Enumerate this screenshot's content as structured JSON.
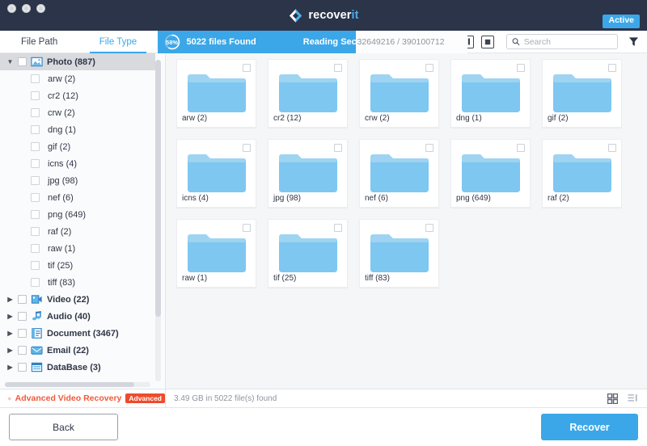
{
  "window": {
    "traffic_lights": [
      "close",
      "minimize",
      "maximize"
    ],
    "brand_main": "recover",
    "brand_accent": "it",
    "status_badge": "Active",
    "titlebar_color": "#2b3449",
    "accent_color": "#3ba7e8"
  },
  "tabs": [
    {
      "label": "File Path",
      "active": false
    },
    {
      "label": "File Type",
      "active": true
    }
  ],
  "scan": {
    "percent": "58%",
    "percent_value": 58,
    "files_found": "5022 files Found",
    "sectors_label": "Reading Sectors:",
    "sectors_value": "32649216 / 390100712"
  },
  "toolbar": {
    "pause_icon": "pause-icon",
    "stop_icon": "stop-icon",
    "search_placeholder": "Search",
    "search_value": "",
    "search_icon": "search-icon",
    "filter_icon": "filter-funnel-icon"
  },
  "sidebar": {
    "groups": [
      {
        "label": "Photo (887)",
        "icon": "photo-icon",
        "expanded": true,
        "selected": true,
        "children": [
          {
            "label": "arw (2)"
          },
          {
            "label": "cr2 (12)"
          },
          {
            "label": "crw (2)"
          },
          {
            "label": "dng (1)"
          },
          {
            "label": "gif (2)"
          },
          {
            "label": "icns (4)"
          },
          {
            "label": "jpg (98)"
          },
          {
            "label": "nef (6)"
          },
          {
            "label": "png (649)"
          },
          {
            "label": "raf (2)"
          },
          {
            "label": "raw (1)"
          },
          {
            "label": "tif (25)"
          },
          {
            "label": "tiff (83)"
          }
        ]
      },
      {
        "label": "Video (22)",
        "icon": "video-icon",
        "expanded": false,
        "selected": false,
        "children": []
      },
      {
        "label": "Audio (40)",
        "icon": "audio-icon",
        "expanded": false,
        "selected": false,
        "children": []
      },
      {
        "label": "Document (3467)",
        "icon": "document-icon",
        "expanded": false,
        "selected": false,
        "children": []
      },
      {
        "label": "Email (22)",
        "icon": "email-icon",
        "expanded": false,
        "selected": false,
        "children": []
      },
      {
        "label": "DataBase (3)",
        "icon": "database-icon",
        "expanded": false,
        "selected": false,
        "children": []
      }
    ]
  },
  "content": {
    "folders": [
      {
        "label": "arw (2)"
      },
      {
        "label": "cr2 (12)"
      },
      {
        "label": "crw (2)"
      },
      {
        "label": "dng (1)"
      },
      {
        "label": "gif (2)"
      },
      {
        "label": "icns (4)"
      },
      {
        "label": "jpg (98)"
      },
      {
        "label": "nef (6)"
      },
      {
        "label": "png (649)"
      },
      {
        "label": "raf (2)"
      },
      {
        "label": "raw (1)"
      },
      {
        "label": "tif (25)"
      },
      {
        "label": "tiff (83)"
      }
    ]
  },
  "statusbar": {
    "advanced_label": "Advanced Video Recovery",
    "advanced_badge": "Advanced",
    "advanced_icon": "advanced-recovery-icon",
    "summary": "3.49 GB in 5022 file(s) found",
    "grid_view_icon": "grid-view-icon",
    "list_view_icon": "list-view-icon",
    "active_view": "grid"
  },
  "footer": {
    "back_label": "Back",
    "recover_label": "Recover"
  }
}
